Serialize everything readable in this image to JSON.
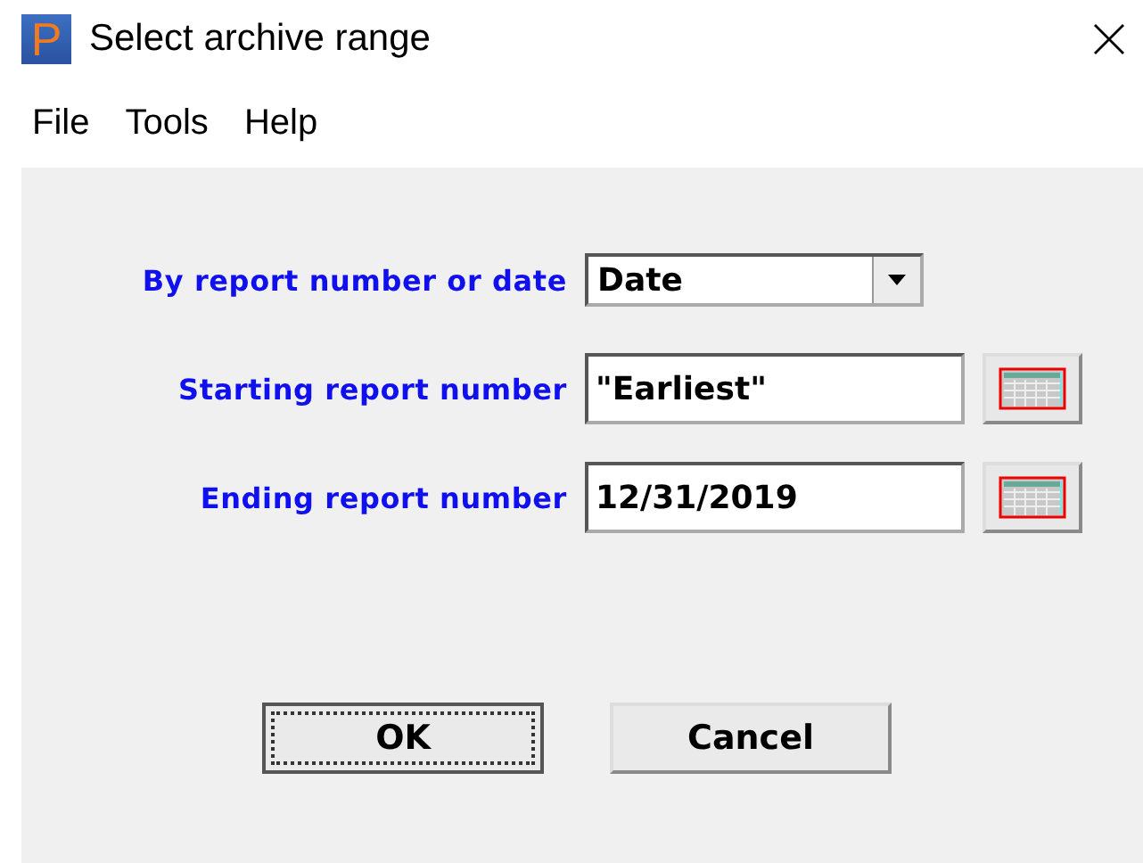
{
  "window": {
    "title": "Select archive range",
    "icon_letter": "P"
  },
  "menu": [
    "File",
    "Tools",
    "Help"
  ],
  "fields": [
    {
      "kind": "dropdown",
      "label": "By report number or date",
      "value": "Date"
    },
    {
      "kind": "date",
      "label": "Starting report number",
      "value": "\"Earliest\""
    },
    {
      "kind": "date",
      "label": "Ending report number",
      "value": "12/31/2019"
    }
  ],
  "buttons": [
    {
      "label": "OK",
      "focused": true
    },
    {
      "label": "Cancel",
      "focused": false
    }
  ]
}
